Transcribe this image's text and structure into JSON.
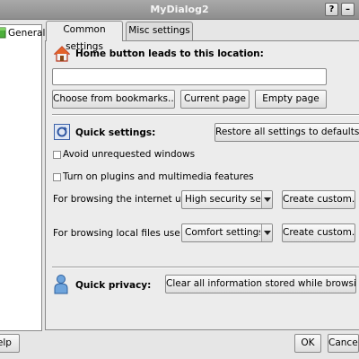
{
  "window": {
    "title": "MyDialog2",
    "help_glyph": "?",
    "minimize_glyph": "–"
  },
  "sidebar": {
    "items": [
      {
        "label": "General",
        "icon": "general-settings-icon"
      }
    ]
  },
  "tabs": [
    {
      "label": "Common settings",
      "active": true
    },
    {
      "label": "Misc settings",
      "active": false
    }
  ],
  "home": {
    "heading": "Home button leads to this location:",
    "location_value": "",
    "buttons": {
      "bookmarks": "Choose from bookmarks...",
      "current": "Current page",
      "empty": "Empty page"
    }
  },
  "quick_settings": {
    "heading": "Quick settings:",
    "restore_button": "Restore all settings to defaults...",
    "checkboxes": [
      {
        "label": "Avoid unrequested windows",
        "checked": false
      },
      {
        "label": "Turn on plugins and multimedia features",
        "checked": false
      }
    ],
    "internet": {
      "label": "For browsing the internet use:",
      "value": "High security settings",
      "custom_button": "Create custom..."
    },
    "local": {
      "label": "For browsing local files use:",
      "value": "Comfort settings",
      "custom_button": "Create custom..."
    }
  },
  "privacy": {
    "heading": "Quick privacy:",
    "clear_button": "Clear all information stored while browsing"
  },
  "footer": {
    "help": "Help",
    "ok": "OK",
    "cancel": "Cancel"
  },
  "colors": {
    "titlebar": "#999999",
    "window_bg": "#e6e6e6",
    "pane_bg": "#ececec",
    "border": "#8a8a8a"
  }
}
